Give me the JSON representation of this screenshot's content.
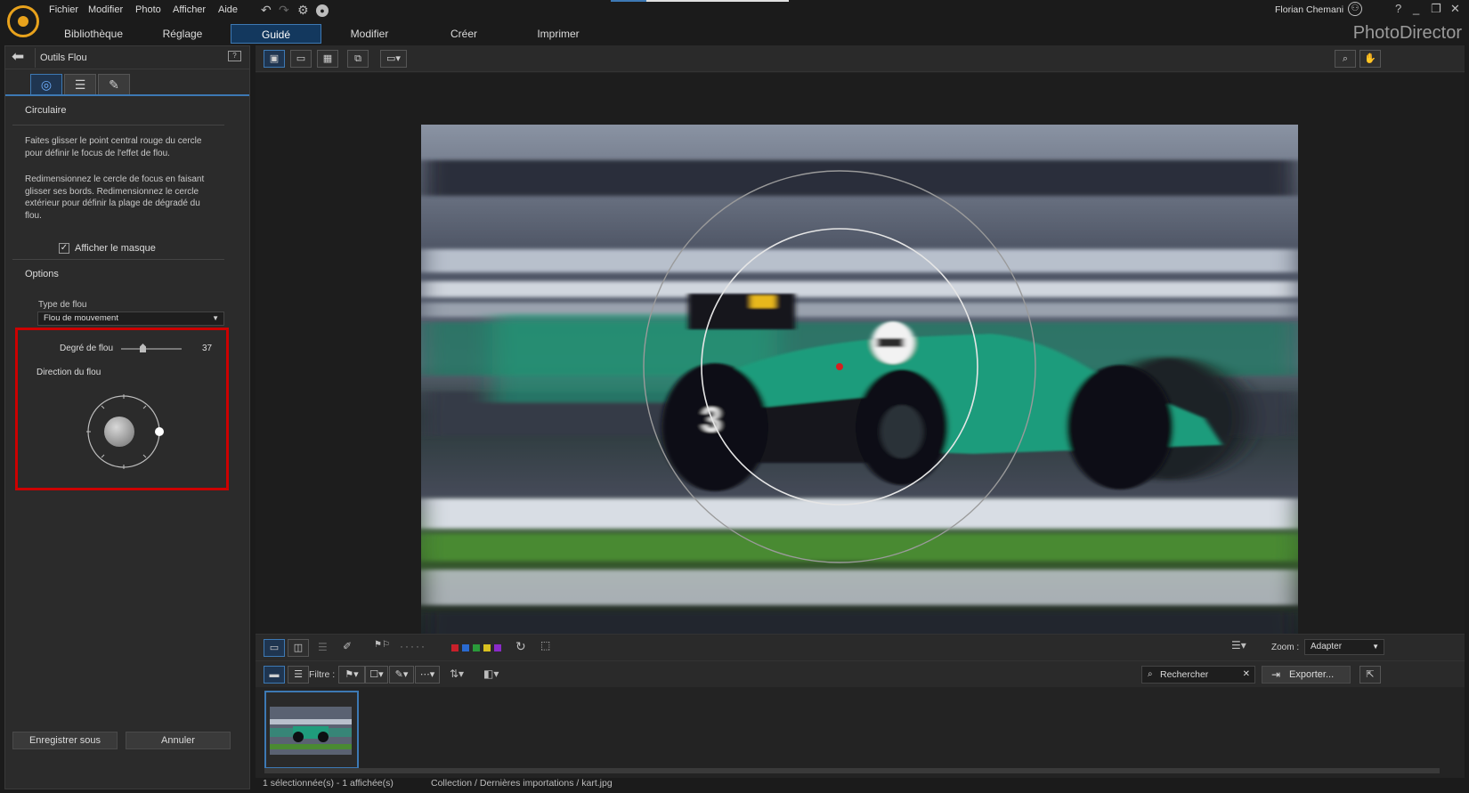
{
  "app": {
    "name": "PhotoDirector",
    "user": "Florian Chemani"
  },
  "menu": [
    "Fichier",
    "Modifier",
    "Photo",
    "Afficher",
    "Aide"
  ],
  "main_tabs": [
    {
      "label": "Bibliothèque"
    },
    {
      "label": "Réglage"
    },
    {
      "label": "Guidé"
    },
    {
      "label": "Modifier"
    },
    {
      "label": "Créer"
    },
    {
      "label": "Imprimer"
    }
  ],
  "left_panel": {
    "title": "Outils Flou",
    "section_circular": "Circulaire",
    "desc1": "Faites glisser le point central rouge du cercle pour définir le focus de l'effet de flou.",
    "desc2": "Redimensionnez le cercle de focus en faisant glisser ses bords. Redimensionnez le cercle extérieur pour définir la plage de dégradé du flou.",
    "show_mask_label": "Afficher le masque",
    "show_mask_checked": true,
    "options_title": "Options",
    "blur_type_label": "Type de flou",
    "blur_type_value": "Flou de mouvement",
    "blur_degree_label": "Degré de flou",
    "blur_degree_value": "37",
    "blur_direction_label": "Direction du flou",
    "save_as_label": "Enregistrer sous",
    "cancel_label": "Annuler"
  },
  "filmstrip": {
    "filter_label": "Filtre :",
    "search_placeholder": "Rechercher",
    "export_label": "Exporter...",
    "zoom_label": "Zoom :",
    "zoom_value": "Adapter"
  },
  "status": {
    "selection": "1 sélectionnée(s) - 1 affichée(s)",
    "path": "Collection / Dernières importations / kart.jpg"
  },
  "colors": {
    "accent": "#3d79b4",
    "highlight_box": "#cc0000",
    "logo": "#e8a21c",
    "car_green": "#1f9c7c",
    "label_red": "#c8202a",
    "label_blue": "#2a6ad0",
    "label_green": "#2a9a3a",
    "label_yellow": "#d8c020",
    "label_purple": "#8a2ac8"
  }
}
